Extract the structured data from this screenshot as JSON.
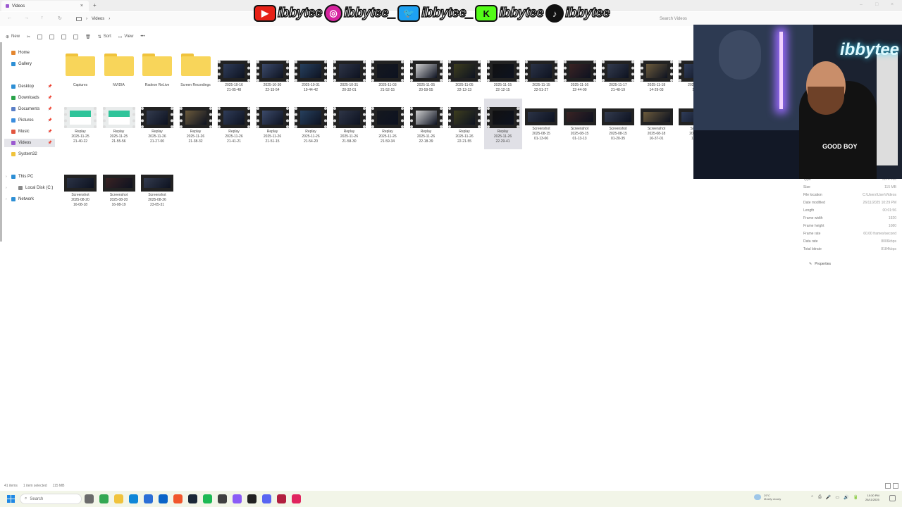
{
  "window": {
    "tab_title": "Videos",
    "new_tab": "+",
    "close_tab": "×",
    "minimize": "–",
    "maximize": "□",
    "close": "×"
  },
  "address": {
    "breadcrumb": "Videos",
    "separator": "›",
    "search_placeholder": "Search Videos"
  },
  "banner": {
    "items": [
      {
        "icon": "youtube-icon",
        "glyph": "▶",
        "color": "#e62117",
        "handle": "ibbytee"
      },
      {
        "icon": "instagram-icon",
        "glyph": "◎",
        "color": "#d6249f",
        "handle": "ibbytee_"
      },
      {
        "icon": "twitter-icon",
        "glyph": "🐦",
        "color": "#1da1f2",
        "handle": "ibbytee_"
      },
      {
        "icon": "kick-icon",
        "glyph": "K",
        "color": "#53fc18",
        "handle": "ibbytee"
      },
      {
        "icon": "tiktok-icon",
        "glyph": "♪",
        "color": "#111111",
        "handle": "ibbytee"
      }
    ]
  },
  "commandbar": {
    "new": "New",
    "sort": "Sort",
    "view": "View",
    "more": "•••"
  },
  "sidebar": {
    "quick": [
      {
        "label": "Home",
        "color": "#e4862f"
      },
      {
        "label": "Gallery",
        "color": "#2d8fd5"
      }
    ],
    "pinned": [
      {
        "label": "Desktop",
        "color": "#2d8fd5"
      },
      {
        "label": "Downloads",
        "color": "#2aa34a"
      },
      {
        "label": "Documents",
        "color": "#5b7fc7"
      },
      {
        "label": "Pictures",
        "color": "#3a8dde"
      },
      {
        "label": "Music",
        "color": "#e2553f"
      },
      {
        "label": "Videos",
        "color": "#9b59d0"
      },
      {
        "label": "System32",
        "color": "#f0c33c"
      }
    ],
    "tree": [
      {
        "label": "This PC",
        "color": "#2d8fd5"
      },
      {
        "label": "Local Disk (C:)",
        "color": "#888888"
      },
      {
        "label": "Network",
        "color": "#2d8fd5"
      }
    ],
    "pin_glyph": "📌",
    "expand_glyph": "›"
  },
  "files": {
    "row1": [
      {
        "kind": "folder",
        "name": "Captures"
      },
      {
        "kind": "folder",
        "name": "NVIDIA"
      },
      {
        "kind": "folder",
        "name": "Radeon ReLive"
      },
      {
        "kind": "folder",
        "name": "Screen Recordings"
      },
      {
        "kind": "video",
        "line1": "2025-10-16",
        "line2": "21-05-48"
      },
      {
        "kind": "video",
        "line1": "2025-10-30",
        "line2": "22-15-54"
      },
      {
        "kind": "video",
        "line1": "2025-10-31",
        "line2": "19-44-42"
      },
      {
        "kind": "video",
        "line1": "2025-10-31",
        "line2": "20-32-01"
      },
      {
        "kind": "video",
        "line1": "2025-11-03",
        "line2": "21-52-15"
      },
      {
        "kind": "video",
        "line1": "2025-11-05",
        "line2": "20-59-55"
      },
      {
        "kind": "video",
        "line1": "2025-11-05",
        "line2": "22-13-13"
      },
      {
        "kind": "video",
        "line1": "2025-11-15",
        "line2": "22-12-15"
      },
      {
        "kind": "video",
        "line1": "2025-11-15",
        "line2": "22-51-27"
      },
      {
        "kind": "video",
        "line1": "2025-11-16",
        "line2": "22-44-00"
      },
      {
        "kind": "video",
        "line1": "2025-11-17",
        "line2": "21-48-19"
      },
      {
        "kind": "video",
        "line1": "2025-11-18",
        "line2": "14-29-03"
      },
      {
        "kind": "video",
        "line1": "2025-11-",
        "line2": "15-"
      }
    ],
    "row2": [
      {
        "kind": "video",
        "style": "green",
        "line0": "Replay",
        "line1": "2025-11-25",
        "line2": "21-40-22"
      },
      {
        "kind": "video",
        "style": "green",
        "line0": "Replay",
        "line1": "2025-11-25",
        "line2": "21-55-56"
      },
      {
        "kind": "video",
        "line0": "Replay",
        "line1": "2025-11-26",
        "line2": "21-27-00"
      },
      {
        "kind": "video",
        "line0": "Replay",
        "line1": "2025-11-26",
        "line2": "21-38-32"
      },
      {
        "kind": "video",
        "line0": "Replay",
        "line1": "2025-11-26",
        "line2": "21-41-21"
      },
      {
        "kind": "video",
        "line0": "Replay",
        "line1": "2025-11-26",
        "line2": "21-51-15"
      },
      {
        "kind": "video",
        "line0": "Replay",
        "line1": "2025-11-26",
        "line2": "21-54-20"
      },
      {
        "kind": "video",
        "line0": "Replay",
        "line1": "2025-11-26",
        "line2": "21-58-30"
      },
      {
        "kind": "video",
        "line0": "Replay",
        "line1": "2025-11-26",
        "line2": "21-59-34"
      },
      {
        "kind": "video",
        "line0": "Replay",
        "line1": "2025-11-26",
        "line2": "22-18-39"
      },
      {
        "kind": "video",
        "line0": "Replay",
        "line1": "2025-11-26",
        "line2": "22-21-55"
      },
      {
        "kind": "video",
        "selected": true,
        "line0": "Replay",
        "line1": "2025-11-26",
        "line2": "22-29-41"
      },
      {
        "kind": "shot",
        "line0": "Screenshot",
        "line1": "2025-08-15",
        "line2": "01-13-06"
      },
      {
        "kind": "shot",
        "line0": "Screenshot",
        "line1": "2025-08-15",
        "line2": "01-13-13"
      },
      {
        "kind": "shot",
        "line0": "Screenshot",
        "line1": "2025-08-15",
        "line2": "01-20-35"
      },
      {
        "kind": "shot",
        "line0": "Screenshot",
        "line1": "2025-08-18",
        "line2": "16-37-01"
      },
      {
        "kind": "shot",
        "line0": "Scree",
        "line1": "2025-0",
        "line2": "16-3"
      }
    ],
    "row3": [
      {
        "kind": "shot",
        "line0": "Screenshot",
        "line1": "2025-08-20",
        "line2": "16-08-18"
      },
      {
        "kind": "shot",
        "line0": "Screenshot",
        "line1": "2025-08-20",
        "line2": "16-08-19"
      },
      {
        "kind": "shot",
        "line0": "Screenshot",
        "line1": "2025-08-26",
        "line2": "23-05-31"
      }
    ]
  },
  "details": {
    "rows": [
      {
        "label": "Type",
        "value": "MP4 File"
      },
      {
        "label": "Size",
        "value": "115 MB"
      },
      {
        "label": "File location",
        "value": "C:\\Users\\User\\Videos"
      },
      {
        "label": "Date modified",
        "value": "26/11/2025 10:29 PM"
      },
      {
        "label": "Length",
        "value": "00:01:56"
      },
      {
        "label": "Frame width",
        "value": "1920"
      },
      {
        "label": "Frame height",
        "value": "1080"
      },
      {
        "label": "Frame rate",
        "value": "60.00 frames/second"
      },
      {
        "label": "Data rate",
        "value": "8006kbps"
      },
      {
        "label": "Total bitrate",
        "value": "8184kbps"
      }
    ],
    "properties": "Properties",
    "properties_icon": "✎"
  },
  "webcam": {
    "sign": "ibbytee",
    "shirt": "GOOD BOY"
  },
  "status": {
    "items": "41 items",
    "selected": "1 item selected",
    "size": "115 MB"
  },
  "taskbar": {
    "search": "Search",
    "search_icon": "⌕",
    "apps": [
      {
        "name": "task-view",
        "color": "#6b6b6b"
      },
      {
        "name": "chrome",
        "color": "#34a853"
      },
      {
        "name": "file-explorer",
        "color": "#f0c33c"
      },
      {
        "name": "edge",
        "color": "#0f87d8"
      },
      {
        "name": "store",
        "color": "#2b6fd6"
      },
      {
        "name": "outlook",
        "color": "#0a64c8"
      },
      {
        "name": "brave",
        "color": "#f1562b"
      },
      {
        "name": "steam",
        "color": "#1b2838"
      },
      {
        "name": "spotify",
        "color": "#1db954"
      },
      {
        "name": "obs",
        "color": "#404040"
      },
      {
        "name": "messenger",
        "color": "#8a5cf6"
      },
      {
        "name": "terminal",
        "color": "#222222"
      },
      {
        "name": "discord",
        "color": "#5865f2"
      },
      {
        "name": "davinci",
        "color": "#b11f3f"
      },
      {
        "name": "capcut",
        "color": "#e0245e"
      }
    ],
    "weather_temp": "29°C",
    "weather_desc": "Mostly cloudy",
    "tray_glyphs": [
      "⌃",
      "⎙",
      "🎤",
      "▭",
      "🔊",
      "🔋"
    ],
    "time": "10:30 PM",
    "date": "26/11/2025"
  }
}
